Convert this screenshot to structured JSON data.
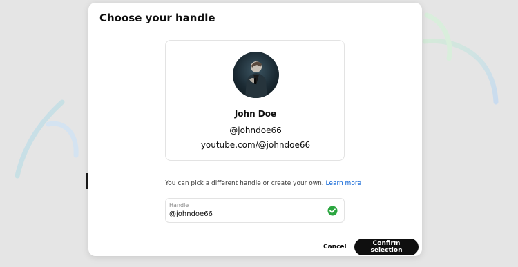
{
  "dialog": {
    "title": "Choose your handle"
  },
  "profile": {
    "name": "John Doe",
    "handle": "@johndoe66",
    "url": "youtube.com/@johndoe66"
  },
  "help": {
    "text": "You can pick a different handle or create your own.",
    "link_label": "Learn more"
  },
  "handle_input": {
    "label": "Handle",
    "value": "@johndoe66",
    "status_icon": "check-circle-icon",
    "status_color": "#2ba640"
  },
  "actions": {
    "cancel_label": "Cancel",
    "confirm_label": "Confirm selection"
  },
  "colors": {
    "primary_button": "#0f0f0f",
    "link": "#065fd4",
    "backdrop": "#e5e5e5"
  }
}
